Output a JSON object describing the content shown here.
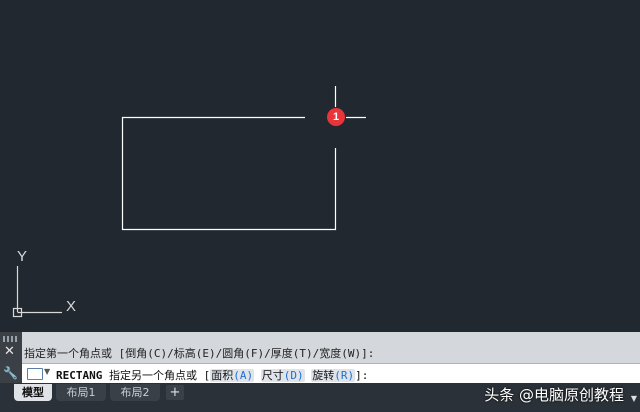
{
  "viewport": {
    "marker_number": "1",
    "ucs": {
      "y_label": "Y",
      "x_label": "X"
    }
  },
  "command_line": {
    "history_text": "指定第一个角点或 [倒角(C)/标高(E)/圆角(F)/厚度(T)/宽度(W)]:",
    "command_name": "RECTANG",
    "prompt_text": "指定另一个角点或 [",
    "options": [
      {
        "label": "面积",
        "key": "(A)"
      },
      {
        "label": "尺寸",
        "key": "(D)"
      },
      {
        "label": "旋转",
        "key": "(R)"
      }
    ],
    "prompt_end": "]:",
    "close_icon": "close-icon",
    "settings_icon": "wrench-icon"
  },
  "tabs": [
    {
      "label": "模型",
      "active": true
    },
    {
      "label": "布局1",
      "active": false
    },
    {
      "label": "布局2",
      "active": false
    }
  ],
  "add_tab_label": "+",
  "watermark": "头条 @电脑原创教程",
  "colors": {
    "canvas_bg": "#212830",
    "geometry": "#ffffff",
    "marker": "#e8343b",
    "command_bg": "#d4d7db",
    "option_key": "#1f6fd1"
  }
}
